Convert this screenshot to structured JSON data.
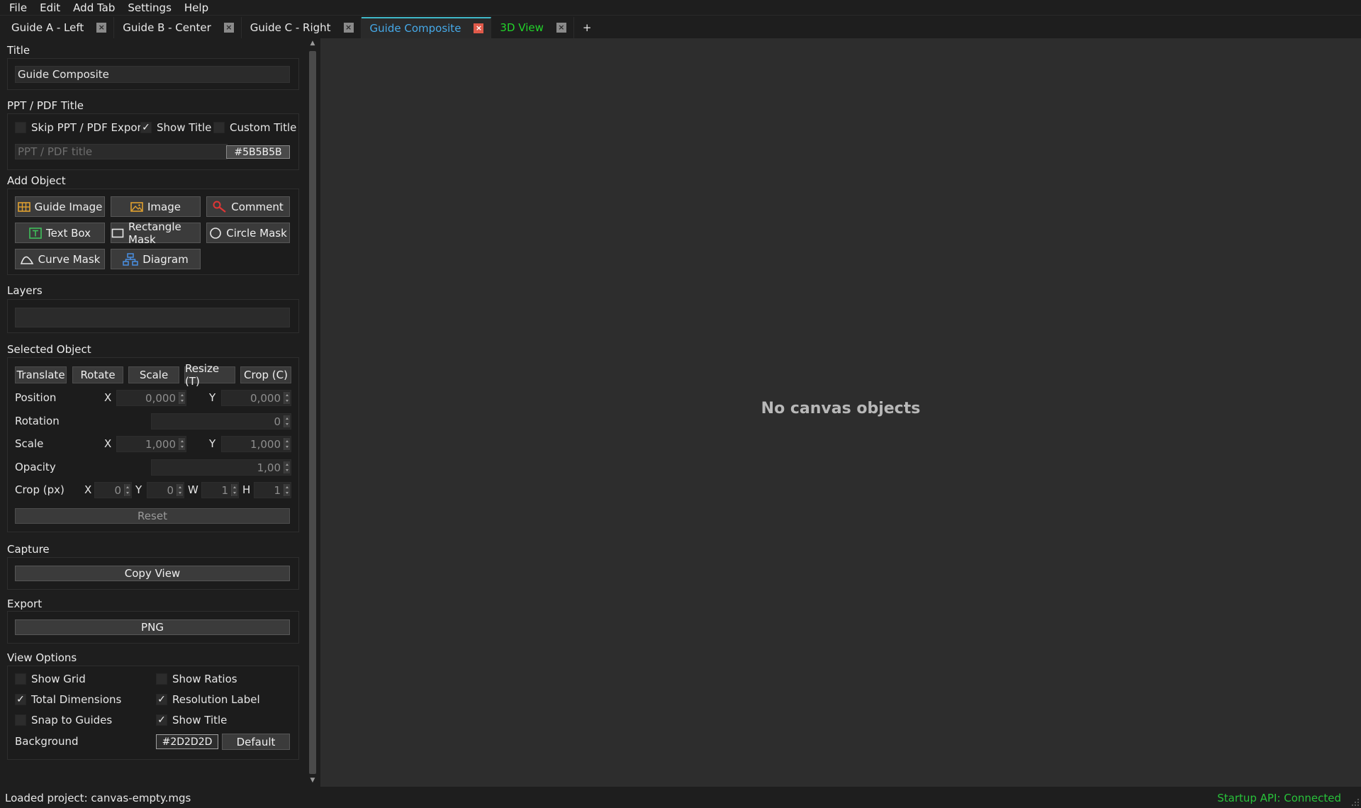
{
  "menu": [
    "File",
    "Edit",
    "Add Tab",
    "Settings",
    "Help"
  ],
  "tabs": [
    {
      "label": "Guide A - Left"
    },
    {
      "label": "Guide B - Center"
    },
    {
      "label": "Guide C - Right"
    },
    {
      "label": "Guide Composite",
      "active": true
    },
    {
      "label": "3D View"
    }
  ],
  "add_tab_label": "+",
  "panel": {
    "title_section": "Title",
    "title_value": "Guide Composite",
    "ppt_section": "PPT / PDF Title",
    "skip_export": "Skip PPT / PDF Export",
    "show_title": "Show Title",
    "custom_title": "Custom Title",
    "ppt_placeholder": "PPT / PDF title",
    "ppt_color": "#5B5B5B",
    "add_object_section": "Add Object",
    "add_buttons": [
      "Guide Image",
      "Image",
      "Comment",
      "Text Box",
      "Rectangle Mask",
      "Circle Mask",
      "Curve Mask",
      "Diagram"
    ],
    "layers_section": "Layers",
    "selected_section": "Selected Object",
    "mode_buttons": [
      "Translate",
      "Rotate",
      "Scale",
      "Resize (T)",
      "Crop (C)"
    ],
    "position_label": "Position",
    "rotation_label": "Rotation",
    "scale_label": "Scale",
    "opacity_label": "Opacity",
    "crop_label": "Crop (px)",
    "axis_x": "X",
    "axis_y": "Y",
    "axis_w": "W",
    "axis_h": "H",
    "position_x": "0,000",
    "position_y": "0,000",
    "rotation": "0",
    "scale_x": "1,000",
    "scale_y": "1,000",
    "opacity": "1,00",
    "crop_x": "0",
    "crop_y": "0",
    "crop_w": "1",
    "crop_h": "1",
    "reset": "Reset",
    "capture_section": "Capture",
    "copy_view": "Copy View",
    "export_section": "Export",
    "png": "PNG",
    "view_section": "View Options",
    "show_grid": "Show Grid",
    "show_ratios": "Show Ratios",
    "total_dimensions": "Total Dimensions",
    "resolution_label": "Resolution Label",
    "snap_to_guides": "Snap to Guides",
    "view_show_title": "Show Title",
    "background_label": "Background",
    "background_color": "#2D2D2D",
    "default_btn": "Default"
  },
  "checks": {
    "skip_export": false,
    "show_title": true,
    "custom_title": false,
    "show_grid": false,
    "show_ratios": false,
    "total_dimensions": true,
    "resolution_label": true,
    "snap_to_guides": false,
    "view_show_title": true
  },
  "canvas_message": "No canvas objects",
  "status": {
    "left": "Loaded project: canvas-empty.mgs",
    "right": "Startup API: Connected"
  },
  "colors": {
    "active_tab": "#46a9e8",
    "green_tab": "#22d32a",
    "status_ok": "#28c23a",
    "canvas_bg": "#2d2d2d"
  }
}
